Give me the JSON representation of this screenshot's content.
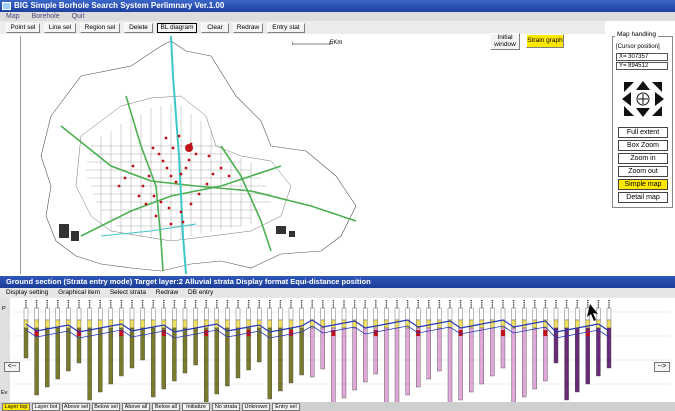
{
  "window": {
    "title": "BIG Simple Borhole Search System Perlimnary Ver.1.00"
  },
  "menu": [
    "Map",
    "Borehole",
    "Quit"
  ],
  "toolbar": {
    "buttons": [
      "Point sel",
      "Line sel",
      "Region sel",
      "Delete",
      "BL diagram",
      "Clear",
      "Redraw",
      "Entry stat"
    ],
    "pressed": "BL diagram",
    "initial_window": "Initial window",
    "strain_graph": "Strain graph"
  },
  "map": {
    "scale_label": "5Km"
  },
  "map_handling": {
    "title": "Map handling",
    "cursor_label": "[Cursor position]",
    "x_value": "X= 307357",
    "y_value": "Y= 894512",
    "buttons": [
      "Full extent",
      "Box Zoom",
      "Zoom in",
      "Zoom out",
      "Simple map",
      "Detail map"
    ],
    "highlighted": "Simple map"
  },
  "ground_section": {
    "title": "Ground section (Strata entry mode)   Target layer:2   Alluvial strata   Display format Equi-distance position",
    "menu": [
      "Display setting",
      "Graphical item",
      "Select strata",
      "Redraw",
      "DB entry"
    ],
    "left_arrow": "<--",
    "right_arrow": "-->",
    "axis_label_top": "P",
    "axis_label_bottom": "Ev"
  },
  "bottom_tabs": {
    "items": [
      "Layer top",
      "Layer bot",
      "Above sel",
      "Below sel",
      "Above all",
      "Below all",
      "Initialize",
      "No strata",
      "Unknown",
      "Entry sel"
    ],
    "active": "Layer top"
  },
  "colors": {
    "title_blue": "#1c40a0",
    "highlight_yellow": "#ffe800",
    "road_green": "#4caf50",
    "river_cyan": "#3ec7c7",
    "borehole_red": "#c0101a",
    "boundary_blue": "#2838b8",
    "stratum_olive": "#7a7a2a",
    "stratum_pink": "#e0a8d8",
    "stratum_yellow": "#f0e060",
    "stratum_purple": "#6a2a7a"
  }
}
